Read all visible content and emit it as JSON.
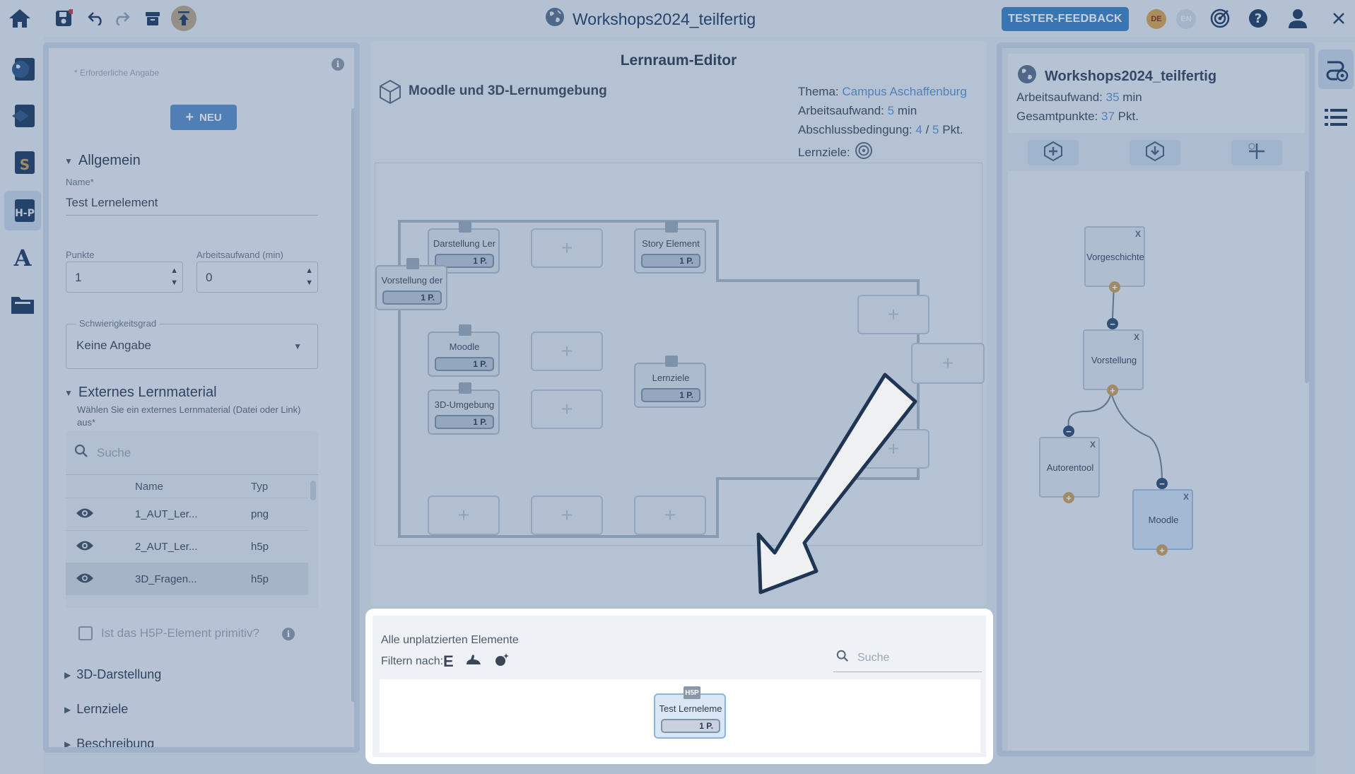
{
  "topbar": {
    "title": "Workshops2024_teilfertig",
    "feedback_label": "TESTER-FEEDBACK",
    "lang_de": "DE",
    "lang_en": "EN"
  },
  "left_panel": {
    "required_hint": "* Erforderliche Angabe",
    "new_button": "NEU",
    "section_general": "Allgemein",
    "name_label": "Name*",
    "name_value": "Test Lernelement",
    "points_label": "Punkte",
    "points_value": "1",
    "effort_label": "Arbeitsaufwand (min)",
    "effort_value": "0",
    "difficulty_label": "Schwierigkeitsgrad",
    "difficulty_value": "Keine Angabe",
    "section_material": "Externes Lernmaterial",
    "material_desc": "Wählen Sie ein externes Lernmaterial (Datei oder Link) aus*",
    "search_placeholder": "Suche",
    "col_name": "Name",
    "col_type": "Typ",
    "files": [
      {
        "name": "1_AUT_Ler...",
        "type": "png"
      },
      {
        "name": "2_AUT_Ler...",
        "type": "h5p"
      },
      {
        "name": "3D_Fragen...",
        "type": "h5p"
      }
    ],
    "primitive_label": "Ist das H5P-Element primitiv?",
    "section_3d": "3D-Darstellung",
    "section_goals": "Lernziele",
    "section_desc": "Beschreibung"
  },
  "editor": {
    "title": "Lernraum-Editor",
    "space_name": "Moodle und 3D-Lernumgebung",
    "theme_label": "Thema:",
    "theme_value": "Campus Aschaffenburg",
    "effort_label": "Arbeitsaufwand:",
    "effort_value": "5",
    "effort_unit": "min",
    "completion_label": "Abschlussbedingung:",
    "completion_required": "4",
    "completion_sep": "/",
    "completion_total": "5",
    "completion_unit": "Pkt.",
    "goals_label": "Lernziele:",
    "elements": [
      {
        "title": "Darstellung Ler",
        "points": "1 P."
      },
      {
        "title": "Story Element",
        "points": "1 P."
      },
      {
        "title": "Vorstellung der",
        "points": "1 P."
      },
      {
        "title": "Moodle",
        "points": "1 P."
      },
      {
        "title": "3D-Umgebung",
        "points": "1 P."
      },
      {
        "title": "Lernziele",
        "points": "1 P."
      }
    ],
    "slot_plus": "+"
  },
  "unplaced": {
    "title": "Alle unplatzierten Elemente",
    "filter_label": "Filtern nach:",
    "search_placeholder": "Suche",
    "item_title": "Test Lerneleme",
    "item_points": "1 P.",
    "item_badge": "H5P"
  },
  "outline": {
    "title": "Workshops2024_teilfertig",
    "effort_label": "Arbeitsaufwand:",
    "effort_value": "35",
    "effort_unit": "min",
    "points_label": "Gesamtpunkte:",
    "points_value": "37",
    "points_unit": "Pkt.",
    "nodes": [
      {
        "label": "Vorgeschichte"
      },
      {
        "label": "Vorstellung"
      },
      {
        "label": "Autorentool"
      },
      {
        "label": "Moodle"
      }
    ],
    "close_x": "X"
  },
  "colors": {
    "accent": "#3b82c4",
    "highlight_value": "#5a93d0",
    "node_plus": "#c9a05c",
    "node_minus": "#2f4d73"
  }
}
